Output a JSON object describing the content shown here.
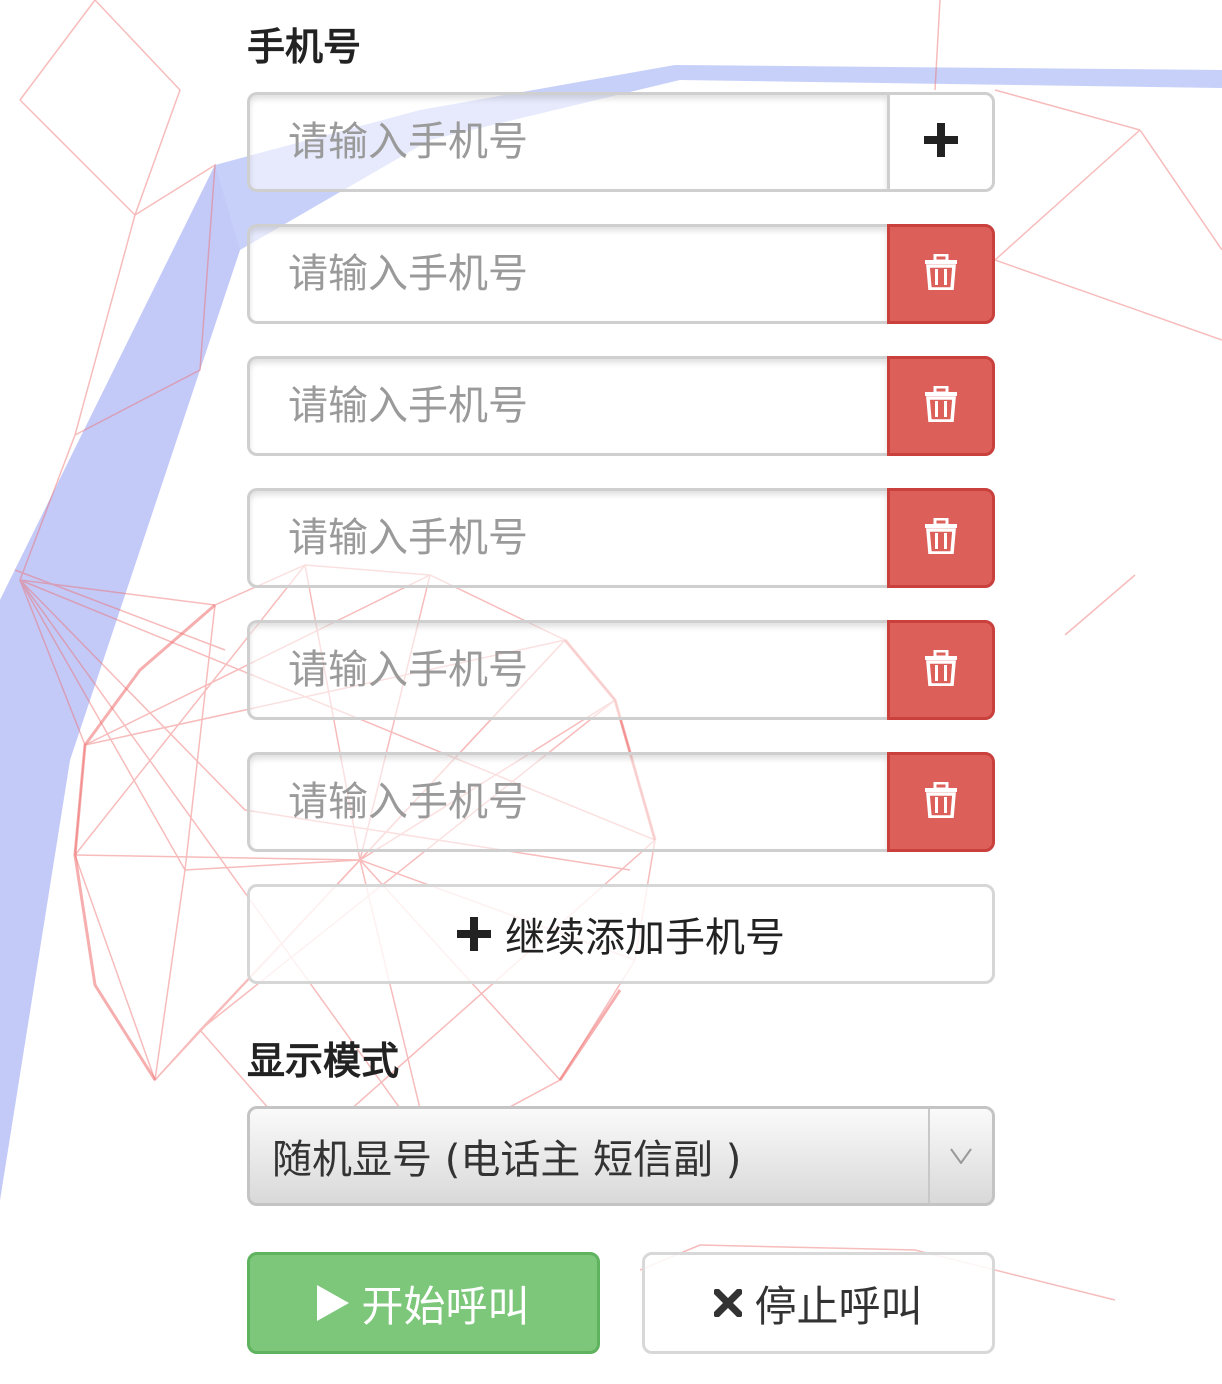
{
  "phone_section": {
    "label": "手机号",
    "placeholder": "请输入手机号",
    "rows": [
      {
        "placeholder": "请输入手机号",
        "action": "add"
      },
      {
        "placeholder": "请输入手机号",
        "action": "delete"
      },
      {
        "placeholder": "请输入手机号",
        "action": "delete"
      },
      {
        "placeholder": "请输入手机号",
        "action": "delete"
      },
      {
        "placeholder": "请输入手机号",
        "action": "delete"
      },
      {
        "placeholder": "请输入手机号",
        "action": "delete"
      }
    ],
    "add_more_label": "继续添加手机号"
  },
  "display_mode": {
    "label": "显示模式",
    "selected": "随机显号 (电话主 短信副 )"
  },
  "actions": {
    "start_label": "开始呼叫",
    "stop_label": "停止呼叫"
  },
  "icons": {
    "add": "plus-icon",
    "delete": "trash-icon",
    "dropdown": "chevron-down-icon",
    "start": "play-icon",
    "stop": "close-icon"
  },
  "colors": {
    "danger": "#dc5f5a",
    "success": "#7cc77a",
    "network_red": "#ee6b6b",
    "network_blue": "#a9b8f5"
  }
}
